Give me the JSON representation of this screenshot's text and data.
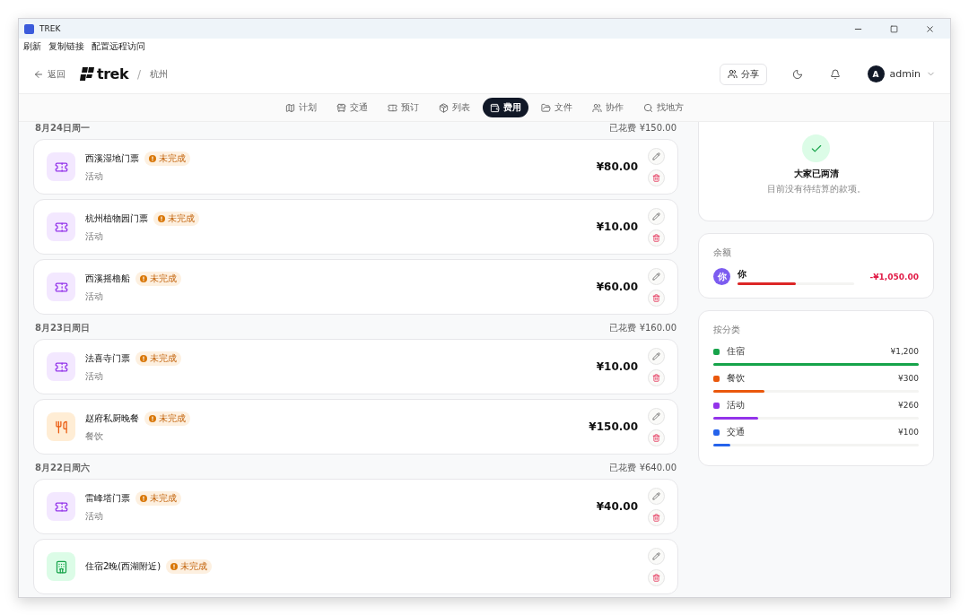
{
  "window": {
    "title": "TREK"
  },
  "menu": [
    "刷新",
    "复制链接",
    "配置远程访问"
  ],
  "header": {
    "back": "返回",
    "logo": "trek",
    "separator": "/",
    "trip": "杭州",
    "share": "分享",
    "user": {
      "initial": "A",
      "name": "admin"
    }
  },
  "tabs": [
    {
      "label": "计划",
      "selected": false
    },
    {
      "label": "交通",
      "selected": false
    },
    {
      "label": "预订",
      "selected": false
    },
    {
      "label": "列表",
      "selected": false
    },
    {
      "label": "费用",
      "selected": true
    },
    {
      "label": "文件",
      "selected": false
    },
    {
      "label": "协作",
      "selected": false
    },
    {
      "label": "找地方",
      "selected": false
    }
  ],
  "days": [
    {
      "date": "8月24日周一",
      "spent": "已花费 ¥150.00",
      "expenses": [
        {
          "kind": "activity",
          "name": "西溪湿地门票",
          "status": "未完成",
          "category": "活动",
          "amount": "¥80.00"
        },
        {
          "kind": "activity",
          "name": "杭州植物园门票",
          "status": "未完成",
          "category": "活动",
          "amount": "¥10.00"
        },
        {
          "kind": "activity",
          "name": "西溪摇橹船",
          "status": "未完成",
          "category": "活动",
          "amount": "¥60.00"
        }
      ]
    },
    {
      "date": "8月23日周日",
      "spent": "已花费 ¥160.00",
      "expenses": [
        {
          "kind": "activity",
          "name": "法喜寺门票",
          "status": "未完成",
          "category": "活动",
          "amount": "¥10.00"
        },
        {
          "kind": "food",
          "name": "赵府私厨晚餐",
          "status": "未完成",
          "category": "餐饮",
          "amount": "¥150.00"
        }
      ]
    },
    {
      "date": "8月22日周六",
      "spent": "已花费 ¥640.00",
      "expenses": [
        {
          "kind": "activity",
          "name": "雷峰塔门票",
          "status": "未完成",
          "category": "活动",
          "amount": "¥40.00"
        },
        {
          "kind": "lodging",
          "name": "住宿2晚(西湖附近)",
          "status": "未完成"
        }
      ]
    }
  ],
  "settled": {
    "title": "大家已两清",
    "text": "目前没有待结算的款项。"
  },
  "balance": {
    "title": "余额",
    "people": [
      {
        "avatar": "你",
        "name": "你",
        "amount": "-¥1,050.00",
        "level": 0.5
      }
    ]
  },
  "by_category": {
    "title": "按分类",
    "items": [
      {
        "name": "住宿",
        "amount": "¥1,200",
        "color": "#16a34a",
        "level": 1
      },
      {
        "name": "餐饮",
        "amount": "¥300",
        "color": "#ea580c",
        "level": 0.25
      },
      {
        "name": "活动",
        "amount": "¥260",
        "color": "#9333ea",
        "level": 0.217
      },
      {
        "name": "交通",
        "amount": "¥100",
        "color": "#2563eb",
        "level": 0.083
      }
    ]
  }
}
